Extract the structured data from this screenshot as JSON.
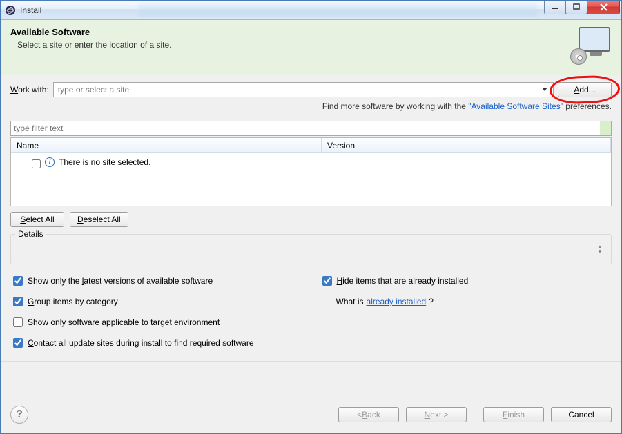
{
  "window": {
    "title": "Install"
  },
  "banner": {
    "title": "Available Software",
    "subtitle": "Select a site or enter the location of a site."
  },
  "work_with": {
    "label_pre": "W",
    "label_post": "ork with:",
    "placeholder": "type or select a site",
    "add_pre": "A",
    "add_post": "dd..."
  },
  "hint": {
    "prefix": "Find more software by working with the ",
    "link": "\"Available Software Sites\"",
    "suffix": " preferences."
  },
  "filter": {
    "placeholder": "type filter text"
  },
  "columns": {
    "name": "Name",
    "version": "Version"
  },
  "tree": {
    "empty_message": "There is no site selected."
  },
  "buttons": {
    "select_all_pre": "S",
    "select_all_post": "elect All",
    "deselect_all_pre": "D",
    "deselect_all_post": "eselect All"
  },
  "details": {
    "label": "Details"
  },
  "options": {
    "show_latest": {
      "pre": "Show only the ",
      "ul": "l",
      "post": "atest versions of available software",
      "checked": true
    },
    "hide_installed": {
      "pre": "",
      "ul": "H",
      "post": "ide items that are already installed",
      "checked": true
    },
    "group_category": {
      "pre": "",
      "ul": "G",
      "post": "roup items by category",
      "checked": true
    },
    "what_is": {
      "prefix": "What is ",
      "link": "already installed",
      "suffix": "?"
    },
    "target_env": {
      "text": "Show only software applicable to target environment",
      "checked": false
    },
    "contact_sites": {
      "pre": "",
      "ul": "C",
      "post": "ontact all update sites during install to find required software",
      "checked": true
    }
  },
  "footer": {
    "back": {
      "lt": "< ",
      "ul": "B",
      "post": "ack"
    },
    "next": {
      "ul": "N",
      "post": "ext >"
    },
    "finish": {
      "ul": "F",
      "post": "inish"
    },
    "cancel": "Cancel"
  }
}
